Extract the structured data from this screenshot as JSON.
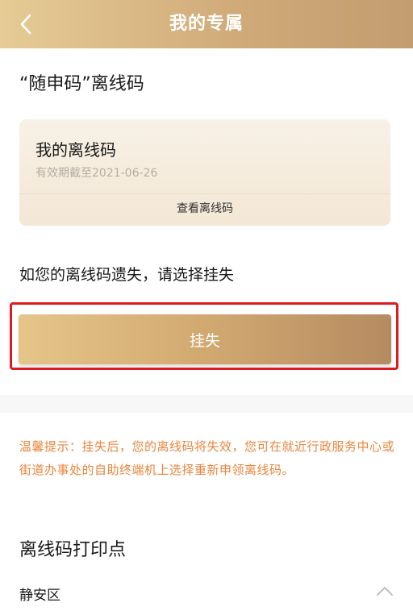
{
  "header": {
    "title": "我的专属",
    "back_icon": "chevron-left-icon"
  },
  "section": {
    "title": "“随申码”离线码"
  },
  "offline_card": {
    "title": "我的离线码",
    "validity": "有效期截至2021-06-26",
    "view_link": "查看离线码"
  },
  "loss": {
    "prompt": "如您的离线码遗失，请选择挂失",
    "button_label": "挂失"
  },
  "tip": {
    "text": "温馨提示：挂失后，您的离线码将失效，您可在就近行政服务中心或街道办事处的自助终端机上选择重新申领离线码。"
  },
  "print_points": {
    "title": "离线码打印点",
    "district": "静安区",
    "expand_icon": "chevron-up-icon"
  },
  "colors": {
    "header_gold": "#d6b382",
    "highlight_red": "#e0191f",
    "tip_orange": "#e8853c"
  }
}
